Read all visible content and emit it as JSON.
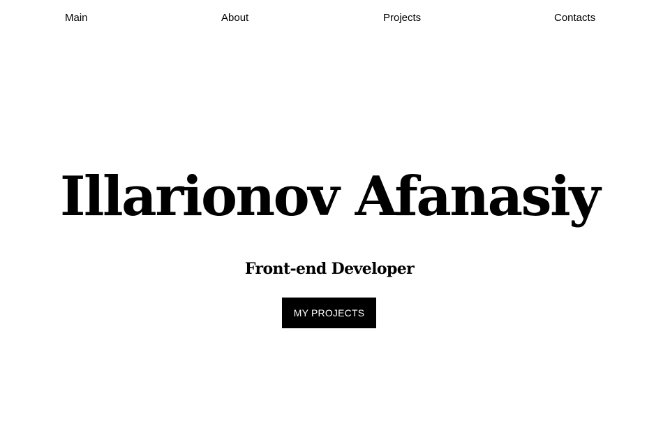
{
  "nav": {
    "items": [
      {
        "label": "Main"
      },
      {
        "label": "About"
      },
      {
        "label": "Projects"
      },
      {
        "label": "Contacts"
      }
    ]
  },
  "hero": {
    "name": "Illarionov Afanasiy",
    "role": "Front-end Developer",
    "cta_label": "MY PROJECTS"
  },
  "colors": {
    "background": "#ffffff",
    "text": "#000000",
    "button_background": "#000000",
    "button_text": "#ffffff"
  }
}
